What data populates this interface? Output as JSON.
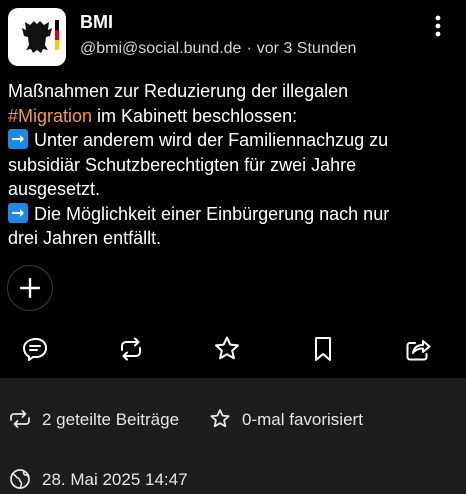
{
  "post": {
    "author_name": "BMI",
    "handle": "@bmi@social.bund.de",
    "separator": "·",
    "time": "vor 3 Stunden",
    "text": {
      "line1": "Maßnahmen zur Reduzierung der illegalen",
      "hashtag": "#Migration",
      "line2_rest": " im Kabinett beschlossen:",
      "line3": "Unter anderem wird der Familiennachzug zu",
      "line4": "subsidiär Schutzberechtigten für zwei Jahre",
      "line5": "ausgesetzt.",
      "line6": "Die Möglichkeit einer Einbürgerung nach nur",
      "line7": "drei Jahren entfällt."
    },
    "icons": {
      "avatar": "federal-eagle-logo",
      "menu": "more-vertical-icon",
      "add_reaction": "plus-icon",
      "reply": "reply-icon",
      "boost": "boost-icon",
      "favorite": "star-icon",
      "bookmark": "bookmark-icon",
      "share": "share-icon",
      "arrow_emoji": "right-arrow-emoji"
    }
  },
  "stats": {
    "boosts": "2 geteilte Beiträge",
    "favorites": "0-mal favorisiert",
    "date": "28. Mai 2025 14:47"
  },
  "colors": {
    "background": "#000000",
    "stats_background": "#1d1c1e",
    "hashtag": "#f29a4a",
    "emoji_blue": "#1e88e5"
  }
}
